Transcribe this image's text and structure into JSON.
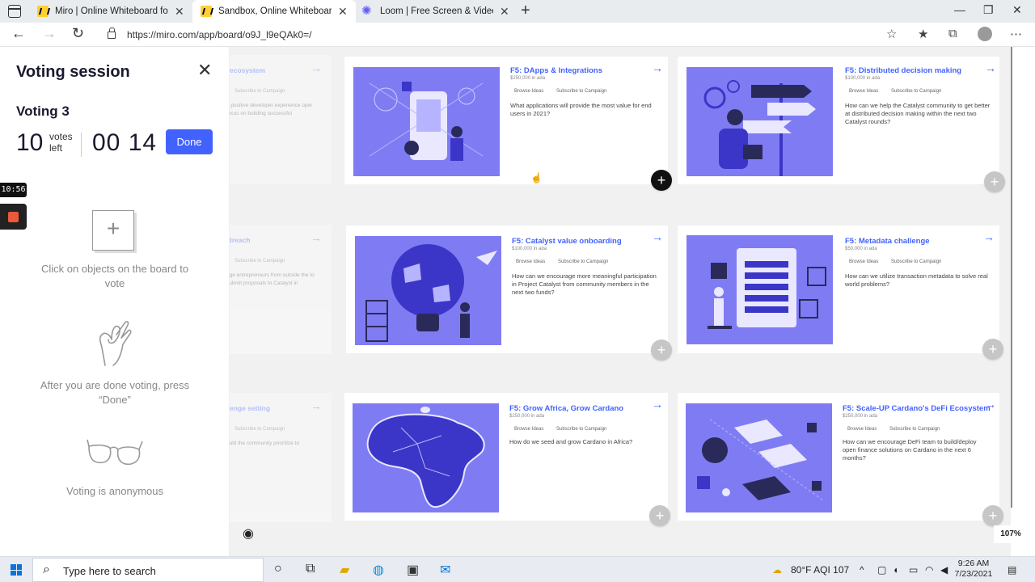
{
  "browser": {
    "tabs": [
      {
        "title": "Miro | Online Whiteboard for Vi",
        "favicon": "miro-icon",
        "active": false
      },
      {
        "title": "Sandbox, Online Whiteboard for",
        "favicon": "miro-icon",
        "active": true
      },
      {
        "title": "Loom | Free Screen & Video Rec",
        "favicon": "loom-icon",
        "active": false
      }
    ],
    "url": "https://miro.com/app/board/o9J_l9eQAk0=/"
  },
  "panel": {
    "title": "Voting session",
    "voting_name": "Voting 3",
    "votes_left": "10",
    "votes_label": "votes left",
    "timer": "00 14",
    "done_label": "Done",
    "recording_time": "10:56",
    "hint_click": "Click on objects on the board to vote",
    "hint_done": "After you are done voting, press “Done”",
    "hint_anon": "Voting is anonymous"
  },
  "board": {
    "faded_cards": [
      {
        "title": "ecosystem",
        "subscribe": "Subscribe to Campaign",
        "desc": "a positive developer experience oper focus on building successful"
      },
      {
        "title": "treach",
        "subscribe": "Subscribe to Campaign",
        "desc": "age entrepreneurs from outside the to submit proposals to Catalyst in"
      },
      {
        "title": "enge setting",
        "subscribe": "Subscribe to Campaign",
        "desc": "ould the community prioritize to"
      }
    ],
    "cards": [
      {
        "title": "F5: DApps & Integrations",
        "amount": "$250,000 in ada",
        "browse": "Browse Ideas",
        "subscribe": "Subscribe to Campaign",
        "desc": "What applications will provide the most value for end users in 2021?"
      },
      {
        "title": "F5: Distributed decision making",
        "amount": "$100,000 in ada",
        "browse": "Browse Ideas",
        "subscribe": "Subscribe to Campaign",
        "desc": "How can we help the Catalyst community to get better at distributed decision making within the next two Catalyst rounds?"
      },
      {
        "title": "F5: Catalyst value onboarding",
        "amount": "$100,000 in ada",
        "browse": "Browse Ideas",
        "subscribe": "Subscribe to Campaign",
        "desc": "How can we encourage more meaningful participation in Project Catalyst from community members in the next two funds?"
      },
      {
        "title": "F5: Metadata challenge",
        "amount": "$50,000 in ada",
        "browse": "Browse Ideas",
        "subscribe": "Subscribe to Campaign",
        "desc": "How can we utilize transaction metadata to solve real world problems?"
      },
      {
        "title": "F5: Grow Africa, Grow Cardano",
        "amount": "$250,000 in ada",
        "browse": "Browse Ideas",
        "subscribe": "Subscribe to Campaign",
        "desc": "How do we seed and grow Cardano in Africa?"
      },
      {
        "title": "F5: Scale-UP Cardano's DeFi Ecosystem",
        "amount": "$250,000 in ada",
        "browse": "Browse Ideas",
        "subscribe": "Subscribe to Campaign",
        "desc": "How can we encourage DeFi team to build/deploy open finance solutions on Cardano in the next 6 months?"
      }
    ],
    "zoom": "107%",
    "accent_color": "#4262ff",
    "illustration_color": "#7f7cf3"
  },
  "taskbar": {
    "search_placeholder": "Type here to search",
    "weather": "80°F  AQI 107",
    "time": "9:26 AM",
    "date": "7/23/2021"
  }
}
